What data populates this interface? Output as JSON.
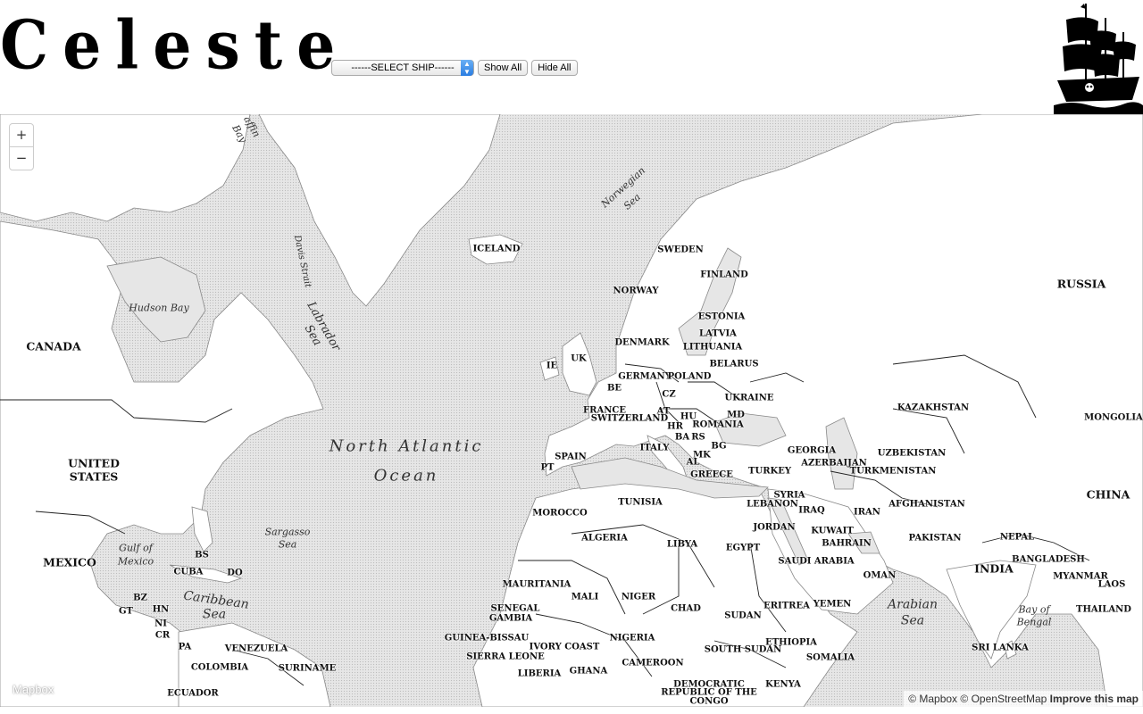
{
  "header": {
    "title": "Celeste",
    "select_value": "------SELECT SHIP------",
    "show_all_label": "Show All",
    "hide_all_label": "Hide All"
  },
  "map": {
    "zoom_in": "+",
    "zoom_out": "−",
    "mapbox_logo": "Mapbox",
    "attribution": {
      "mapbox": "© Mapbox",
      "osm": "© OpenStreetMap",
      "improve": "Improve this map"
    },
    "countries": {
      "canada": "CANADA",
      "united_states_1": "UNITED",
      "united_states_2": "STATES",
      "mexico": "MEXICO",
      "russia": "RUSSIA",
      "china": "CHINA",
      "india": "INDIA",
      "iceland": "ICELAND",
      "sweden": "SWEDEN",
      "finland": "FINLAND",
      "norway": "NORWAY",
      "estonia": "ESTONIA",
      "latvia": "LATVIA",
      "lithuania": "LITHUANIA",
      "denmark": "DENMARK",
      "belarus": "BELARUS",
      "uk": "UK",
      "ie": "IE",
      "germany": "GERMANY",
      "poland": "POLAND",
      "be": "BE",
      "cz": "CZ",
      "ukraine": "UKRAINE",
      "france": "FRANCE",
      "at": "AT",
      "md": "MD",
      "switzerland": "SWITZERLAND",
      "hu": "HU",
      "romania": "ROMANIA",
      "hr": "HR",
      "ba": "BA",
      "rs": "RS",
      "bg": "BG",
      "italy": "ITALY",
      "mk": "MK",
      "al": "AL",
      "spain": "SPAIN",
      "pt": "PT",
      "greece": "GREECE",
      "turkey": "TURKEY",
      "georgia": "GEORGIA",
      "azerbaijan": "AZERBAIJAN",
      "kazakhstan": "KAZAKHSTAN",
      "mongolia": "MONGOLIA",
      "uzbekistan": "UZBEKISTAN",
      "turkmenistan": "TURKMENISTAN",
      "afghanistan": "AFGHANISTAN",
      "pakistan": "PAKISTAN",
      "nepal": "NEPAL",
      "bangladesh": "BANGLADESH",
      "myanmar": "MYANMAR",
      "laos": "LAOS",
      "thailand": "THAILAND",
      "sri_lanka": "SRI LANKA",
      "iran": "IRAN",
      "iraq": "IRAQ",
      "syria": "SYRIA",
      "lebanon": "LEBANON",
      "jordan": "JORDAN",
      "kuwait": "KUWAIT",
      "bahrain": "BAHRAIN",
      "saudi_arabia": "SAUDI ARABIA",
      "oman": "OMAN",
      "yemen": "YEMEN",
      "tunisia": "TUNISIA",
      "morocco": "MOROCCO",
      "algeria": "ALGERIA",
      "libya": "LIBYA",
      "egypt": "EGYPT",
      "mauritania": "MAURITANIA",
      "mali": "MALI",
      "niger": "NIGER",
      "chad": "CHAD",
      "sudan": "SUDAN",
      "eritrea": "ERITREA",
      "ethiopia": "ETHIOPIA",
      "south_sudan": "SOUTH SUDAN",
      "somalia": "SOMALIA",
      "senegal": "SENEGAL",
      "gambia": "GAMBIA",
      "guinea_bissau": "GUINEA-BISSAU",
      "sierra_leone": "SIERRA LEONE",
      "liberia": "LIBERIA",
      "ivory_coast": "IVORY COAST",
      "ghana": "GHANA",
      "nigeria": "NIGERIA",
      "cameroon": "CAMEROON",
      "drc_1": "DEMOCRATIC",
      "drc_2": "REPUBLIC OF THE",
      "drc_3": "CONGO",
      "kenya": "KENYA",
      "bs": "BS",
      "cuba": "CUBA",
      "do": "DO",
      "bz": "BZ",
      "gt": "GT",
      "hn": "HN",
      "ni": "NI",
      "cr": "CR",
      "pa": "PA",
      "venezuela": "VENEZUELA",
      "colombia": "COLOMBIA",
      "suriname": "SURINAME",
      "ecuador": "ECUADOR"
    },
    "waters": {
      "baffin_bay_1": "affin",
      "baffin_bay_2": "Bay",
      "norwegian_sea_1": "Norwegian",
      "norwegian_sea_2": "Sea",
      "davis_strait": "Davis Strait",
      "hudson_bay": "Hudson Bay",
      "labrador_sea_1": "Labrador",
      "labrador_sea_2": "Sea",
      "north_atlantic_1": "North Atlantic",
      "north_atlantic_2": "Ocean",
      "sargasso_sea_1": "Sargasso",
      "sargasso_sea_2": "Sea",
      "gulf_of_mexico_1": "Gulf of",
      "gulf_of_mexico_2": "Mexico",
      "caribbean_sea_1": "Caribbean",
      "caribbean_sea_2": "Sea",
      "arabian_sea_1": "Arabian",
      "arabian_sea_2": "Sea",
      "bay_of_bengal_1": "Bay of",
      "bay_of_bengal_2": "Bengal"
    }
  }
}
